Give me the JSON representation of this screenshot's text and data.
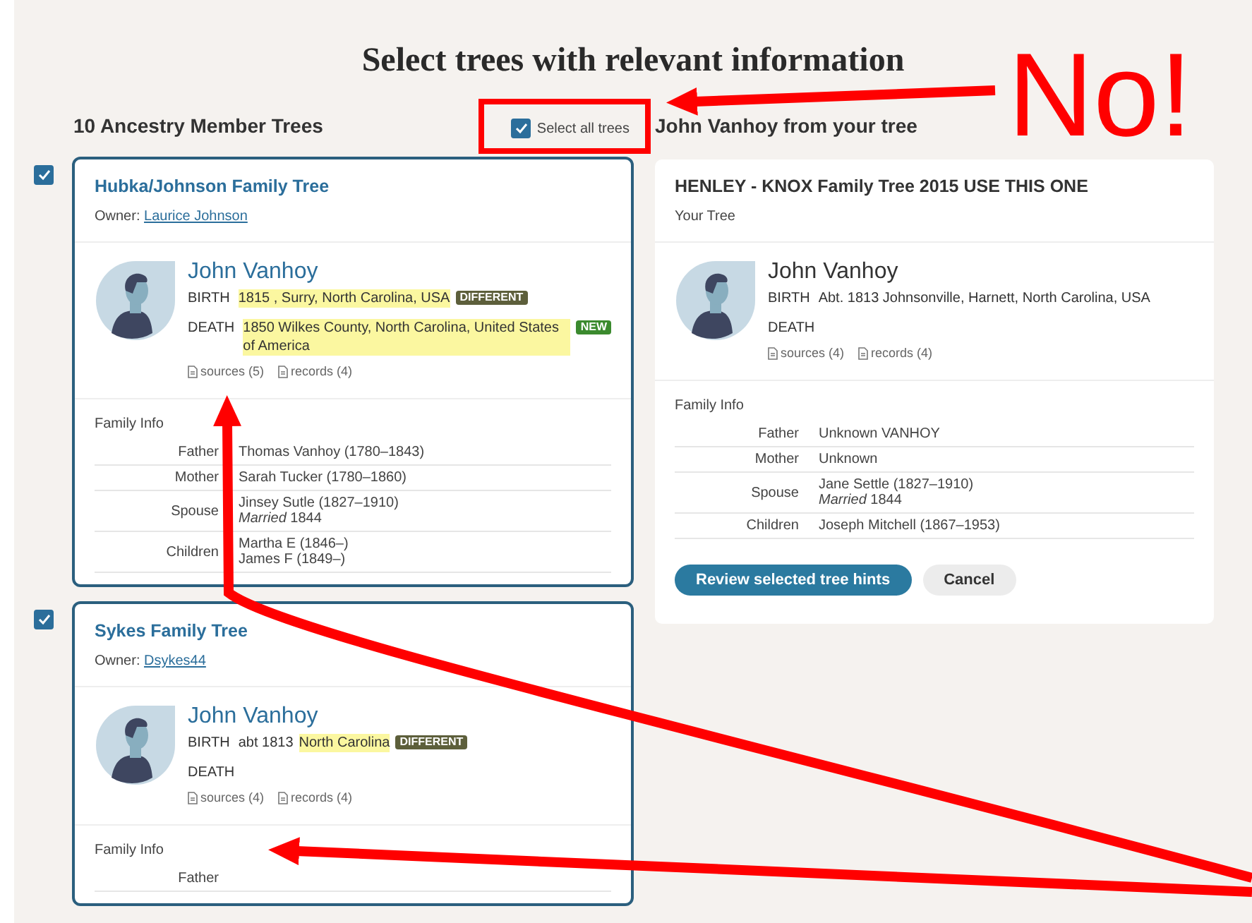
{
  "title": "Select trees with relevant information",
  "left_header": "10 Ancestry Member Trees",
  "select_all": {
    "label": "Select all trees",
    "checked": true
  },
  "right_header": "John Vanhoy from your tree",
  "trees": [
    {
      "selected": true,
      "name": "Hubka/Johnson Family Tree",
      "owner_label": "Owner:",
      "owner": "Laurice Johnson",
      "person": {
        "name": "John Vanhoy",
        "events": [
          {
            "label": "BIRTH",
            "value": "1815 , Surry, North Carolina, USA",
            "highlighted": true,
            "badge": {
              "text": "DIFFERENT",
              "kind": "different"
            }
          },
          {
            "label": "DEATH",
            "value": "1850 Wilkes County, North Carolina, United States of America",
            "highlighted": true,
            "badge": {
              "text": "NEW",
              "kind": "new"
            }
          }
        ],
        "links": [
          "sources (5)",
          "records (4)"
        ]
      },
      "family_label": "Family Info",
      "family": [
        {
          "role": "Father",
          "lines": [
            "Thomas Vanhoy (1780–1843)"
          ]
        },
        {
          "role": "Mother",
          "lines": [
            "Sarah Tucker (1780–1860)"
          ]
        },
        {
          "role": "Spouse",
          "lines": [
            "Jinsey Sutle (1827–1910)",
            "*Married* 1844"
          ]
        },
        {
          "role": "Children",
          "lines": [
            "Martha E (1846–)",
            "James F (1849–)"
          ]
        }
      ]
    },
    {
      "selected": true,
      "name": "Sykes Family Tree",
      "owner_label": "Owner:",
      "owner": "Dsykes44",
      "person": {
        "name": "John Vanhoy",
        "events": [
          {
            "label": "BIRTH",
            "plain": "abt 1813",
            "value": "North Carolina",
            "highlighted": true,
            "badge": {
              "text": "DIFFERENT",
              "kind": "different"
            }
          },
          {
            "label": "DEATH"
          }
        ],
        "links": [
          "sources (4)",
          "records (4)"
        ]
      },
      "family_label": "Family Info",
      "family": [
        {
          "role": "Father"
        }
      ]
    }
  ],
  "your_tree": {
    "name": "HENLEY - KNOX Family Tree 2015 USE THIS ONE",
    "subtitle": "Your Tree",
    "person": {
      "name": "John Vanhoy",
      "events": [
        {
          "label": "BIRTH",
          "plain": "Abt. 1813 Johnsonville, Harnett, North Carolina, USA"
        },
        {
          "label": "DEATH"
        }
      ],
      "links": [
        "sources (4)",
        "records (4)"
      ]
    },
    "family_label": "Family Info",
    "family": [
      {
        "role": "Father",
        "lines": [
          "Unknown VANHOY"
        ]
      },
      {
        "role": "Mother",
        "lines": [
          "Unknown"
        ]
      },
      {
        "role": "Spouse",
        "lines": [
          "Jane Settle (1827–1910)",
          "*Married* 1844"
        ]
      },
      {
        "role": "Children",
        "lines": [
          "Joseph Mitchell (1867–1953)"
        ]
      }
    ],
    "buttons": [
      {
        "label": "Review selected tree hints",
        "kind": "primary"
      },
      {
        "label": "Cancel",
        "kind": "secondary"
      }
    ]
  },
  "annotation": {
    "text": "No!"
  }
}
